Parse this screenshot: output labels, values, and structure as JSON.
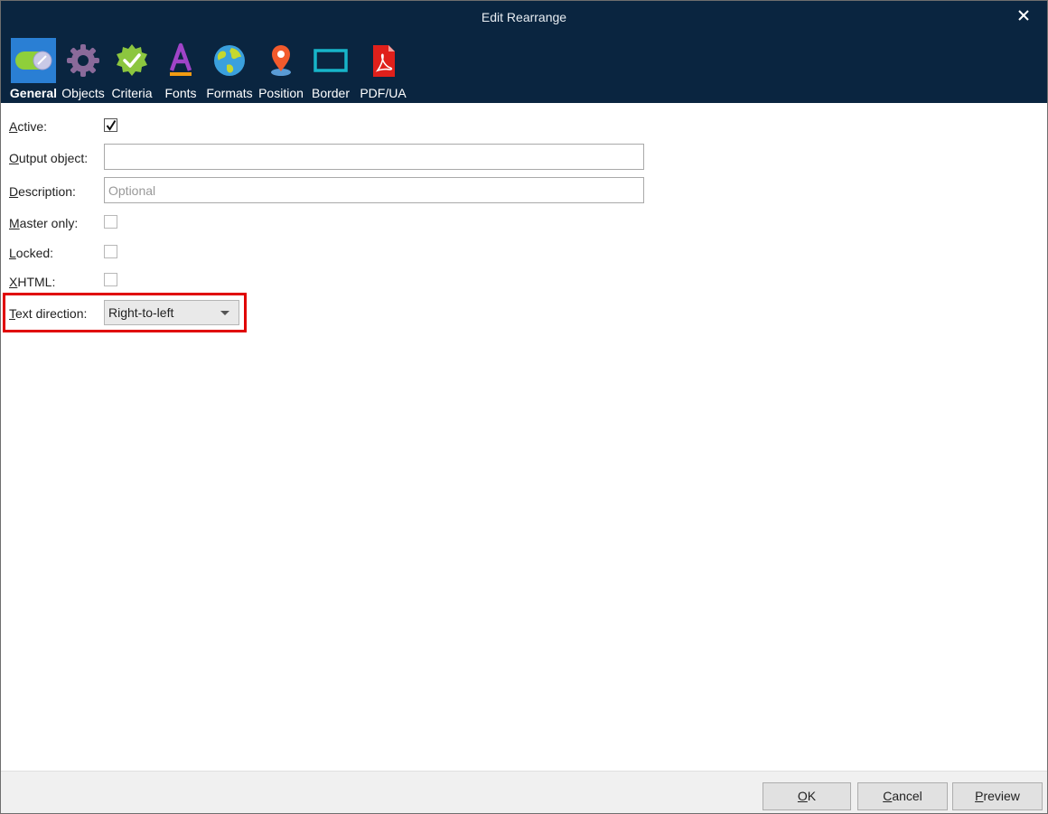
{
  "window": {
    "title": "Edit Rearrange"
  },
  "tabs": [
    {
      "label": "General",
      "icon": "toggle-icon",
      "active": true
    },
    {
      "label": "Objects",
      "icon": "gear-icon"
    },
    {
      "label": "Criteria",
      "icon": "badge-check-icon"
    },
    {
      "label": "Fonts",
      "icon": "font-a-icon"
    },
    {
      "label": "Formats",
      "icon": "globe-icon"
    },
    {
      "label": "Position",
      "icon": "map-pin-icon"
    },
    {
      "label": "Border",
      "icon": "border-square-icon"
    },
    {
      "label": "PDF/UA",
      "icon": "pdf-file-icon"
    }
  ],
  "form": {
    "active": {
      "mnemonic": "A",
      "rest": "ctive:",
      "checked": true
    },
    "output_object": {
      "mnemonic": "O",
      "rest": "utput object:",
      "value": ""
    },
    "description": {
      "mnemonic": "D",
      "rest": "escription:",
      "placeholder": "Optional"
    },
    "master_only": {
      "mnemonic": "M",
      "rest": "aster only:",
      "checked": false
    },
    "locked": {
      "mnemonic": "L",
      "rest": "ocked:",
      "checked": false
    },
    "xhtml": {
      "mnemonic": "X",
      "rest": "HTML:",
      "checked": false
    },
    "text_direction": {
      "mnemonic": "T",
      "rest": "ext direction:",
      "value": "Right-to-left"
    }
  },
  "footer": {
    "ok": {
      "mnemonic": "O",
      "rest": "K"
    },
    "cancel": {
      "mnemonic": "C",
      "rest": "ancel"
    },
    "preview": {
      "mnemonic": "P",
      "rest": "review"
    }
  },
  "colors": {
    "header_bg": "#0a2540",
    "active_tab_bg": "#2a7fd4",
    "highlight": "#e00000"
  }
}
